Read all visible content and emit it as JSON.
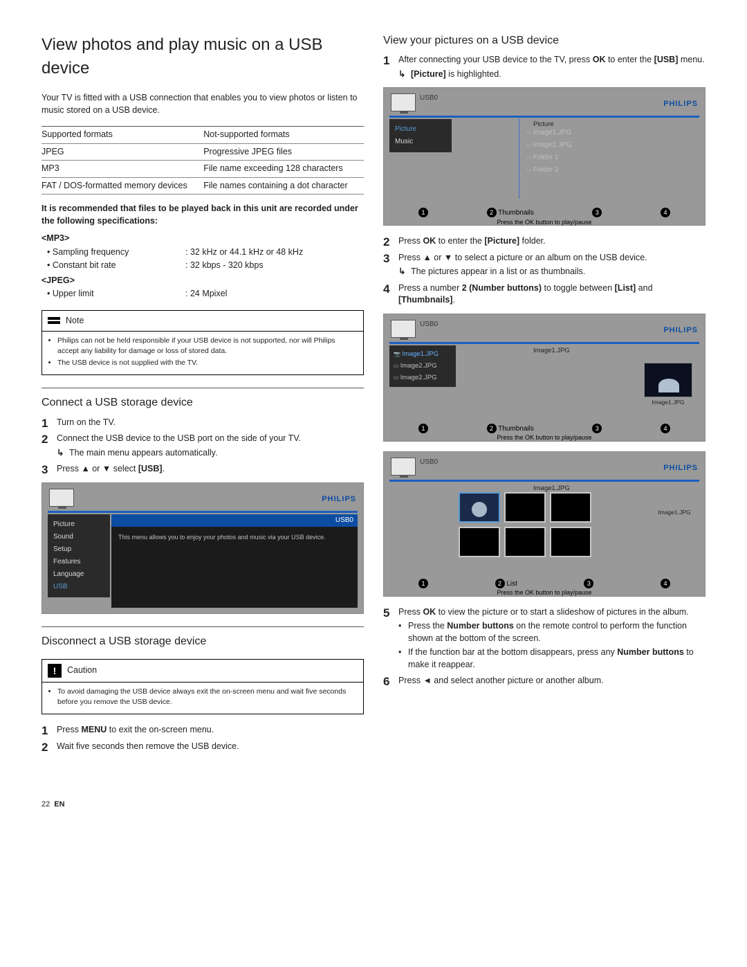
{
  "title": "View photos and play music on a USB device",
  "intro": "Your TV is fitted with a USB connection that enables you to view photos or listen to music stored on a USB device.",
  "formats": {
    "header": [
      "Supported formats",
      "Not-supported formats"
    ],
    "rows": [
      [
        "JPEG",
        "Progressive JPEG files"
      ],
      [
        "MP3",
        "File name exceeding 128 characters"
      ],
      [
        "FAT / DOS-formatted memory devices",
        "File names containing a dot character"
      ]
    ]
  },
  "rec_intro": "It is recommended that files to be played back in this unit are recorded under the following specifications:",
  "specs": {
    "mp3_label": "<MP3>",
    "mp3": [
      {
        "label": "Sampling frequency",
        "value": ": 32 kHz or 44.1 kHz or 48 kHz"
      },
      {
        "label": "Constant bit rate",
        "value": ": 32 kbps - 320 kbps"
      }
    ],
    "jpeg_label": "<JPEG>",
    "jpeg": [
      {
        "label": "Upper limit",
        "value": ": 24 Mpixel"
      }
    ]
  },
  "note": {
    "title": "Note",
    "items": [
      "Philips can not be held responsible if your USB device is not supported, nor will Philips accept any liability for damage or loss of stored data.",
      "The USB device is not supplied with the TV."
    ]
  },
  "connect": {
    "heading": "Connect a USB storage device",
    "steps": [
      {
        "text": "Turn on the TV."
      },
      {
        "text": "Connect the USB device to the USB port on the side of your TV.",
        "result": "The main menu appears automatically."
      },
      {
        "text_pre": "Press ",
        "arrow": "▲ or ▼",
        "text_post": " select ",
        "bold": "[USB]",
        "text_end": "."
      }
    ]
  },
  "tv1": {
    "brand": "PHILIPS",
    "sidebar": [
      "Picture",
      "Sound",
      "Setup",
      "Features",
      "Language",
      "USB"
    ],
    "main_title": "USB0",
    "main_msg": "This menu allows you to enjoy your photos and music via your USB device."
  },
  "disconnect": {
    "heading": "Disconnect a USB storage device",
    "caution_title": "Caution",
    "caution_items": [
      "To avoid damaging the USB device always exit the on-screen menu and wait five seconds before you remove the USB device."
    ],
    "steps": [
      {
        "text_pre": "Press ",
        "bold": "MENU",
        "text_post": " to exit the on-screen menu."
      },
      {
        "text": "Wait five seconds then remove the USB device."
      }
    ]
  },
  "view": {
    "heading": "View your pictures on a USB device",
    "steps": [
      {
        "text_pre": "After connecting your USB device to the TV, press ",
        "bold": "OK",
        "text_mid": " to enter the ",
        "bold2": "[USB]",
        "text_post": " menu.",
        "result_bold": "[Picture]",
        "result_post": " is highlighted."
      },
      {
        "text_pre": "Press ",
        "bold": "OK",
        "text_mid": " to enter the ",
        "bold2": "[Picture]",
        "text_post": " folder."
      },
      {
        "text_pre": "Press ",
        "arrow": "▲ or ▼",
        "text_post": " to select a picture or an album on the USB device.",
        "result": "The pictures appear in a list or as thumbnails."
      },
      {
        "text_pre": "Press a number ",
        "bold": "2 (Number buttons)",
        "text_mid": " to toggle between ",
        "bold2": "[List]",
        "text_mid2": " and ",
        "bold3": "[Thumbnails]",
        "text_post": "."
      },
      {
        "text_pre": "Press ",
        "bold": "OK",
        "text_post": " to view the picture or to start a slideshow of pictures in the album.",
        "subs": [
          {
            "text_pre": "Press the ",
            "bold": "Number buttons",
            "text_post": " on the remote control to perform the function shown at the bottom of the screen."
          },
          {
            "text_pre": "If the function bar at the bottom disappears, press any ",
            "bold": "Number buttons",
            "text_post": " to make it reappear."
          }
        ]
      },
      {
        "text_pre": "Press ",
        "arrow": "◄",
        "text_post": " and select another picture or another album."
      }
    ]
  },
  "tv2": {
    "brand": "PHILIPS",
    "label": "USB0",
    "sublabel": "Picture",
    "sidebar": [
      "Picture",
      "Music"
    ],
    "files": [
      "Image1.JPG",
      "Image2.JPG",
      "Folder 1",
      "Folder 2"
    ],
    "bottom": [
      "1",
      "2",
      "3",
      "4"
    ],
    "bottom_label": "Thumbnails",
    "hint": "Press the OK button to play/pause"
  },
  "tv3": {
    "brand": "PHILIPS",
    "label": "USB0",
    "sublabel": "Image1.JPG",
    "files": [
      "Image1.JPG",
      "Image2.JPG",
      "Image2.JPG"
    ],
    "preview_cap": "Image1.JPG",
    "bottom": [
      "1",
      "2",
      "3",
      "4"
    ],
    "bottom_label": "Thumbnails",
    "hint": "Press the OK button to play/pause"
  },
  "tv4": {
    "brand": "PHILIPS",
    "label": "USB0",
    "sublabel": "Image1.JPG",
    "preview_cap": "Image1.JPG",
    "bottom": [
      "1",
      "2",
      "3",
      "4"
    ],
    "bottom_label": "List",
    "hint": "Press the OK button to play/pause"
  },
  "footer": {
    "page": "22",
    "lang": "EN"
  }
}
